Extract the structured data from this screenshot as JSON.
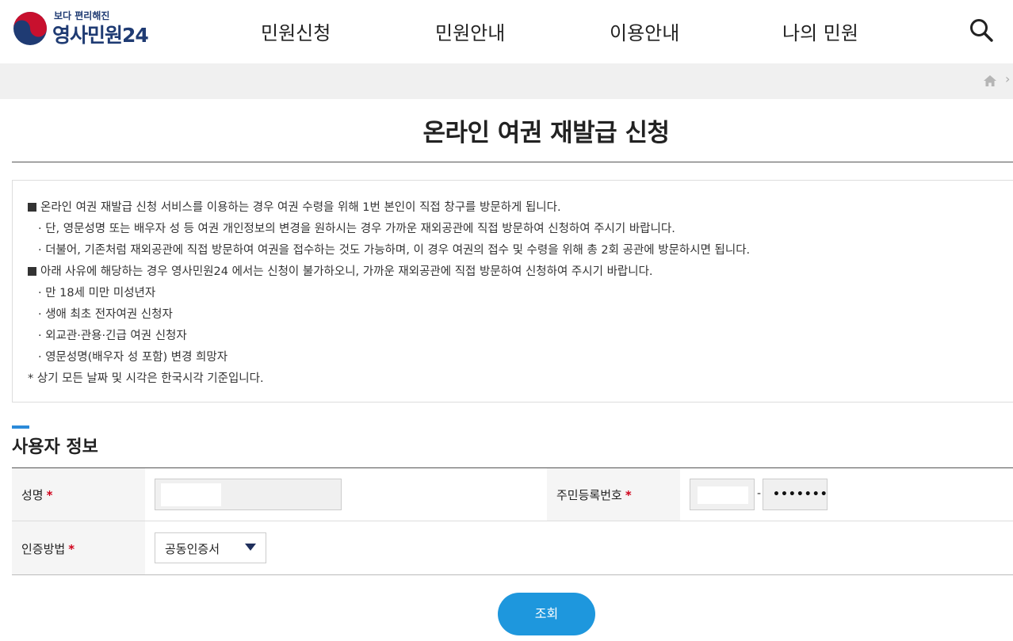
{
  "header": {
    "logo_sub": "보다 편리해진",
    "logo_main": "영사민원24",
    "nav": [
      "민원신청",
      "민원안내",
      "이용안내",
      "나의 민원"
    ],
    "search_icon": "search-icon"
  },
  "breadcrumb": {
    "home_icon": "home-icon",
    "arrow": "›"
  },
  "page_title": "온라인 여권 재발급 신청",
  "notice": {
    "lines": [
      "온라인 여권 재발급 신청 서비스를 이용하는 경우 여권 수령을 위해 1번 본인이 직접 창구를 방문하게 됩니다.",
      "· 단, 영문성명 또는 배우자 성 등 여권 개인정보의 변경을 원하시는 경우 가까운 재외공관에 직접 방문하여 신청하여 주시기 바랍니다.",
      "· 더불어, 기존처럼 재외공관에 직접 방문하여 여권을 접수하는 것도 가능하며, 이 경우 여권의 접수 및 수령을 위해 총 2회 공관에 방문하시면 됩니다.",
      "아래 사유에 해당하는 경우 영사민원24 에서는 신청이 불가하오니, 가까운 재외공관에 직접 방문하여 신청하여 주시기 바랍니다.",
      "· 만 18세 미만 미성년자",
      "· 생애 최초 전자여권 신청자",
      "· 외교관·관용·긴급 여권 신청자",
      "· 영문성명(배우자 성 포함) 변경 희망자",
      "* 상기 모든 날짜 및 시각은 한국시각 기준입니다."
    ]
  },
  "section_title": "사용자 정보",
  "form": {
    "name_label": "성명",
    "rrn_label": "주민등록번호",
    "auth_label": "인증방법",
    "required_mark": "*",
    "rrn_separator": "-",
    "rrn_masked": "•••••••",
    "auth_method": "공동인증서"
  },
  "submit_label": "조회",
  "colors": {
    "brand": "#1f3b73",
    "accent": "#1e97dd",
    "required": "#d0021b"
  }
}
